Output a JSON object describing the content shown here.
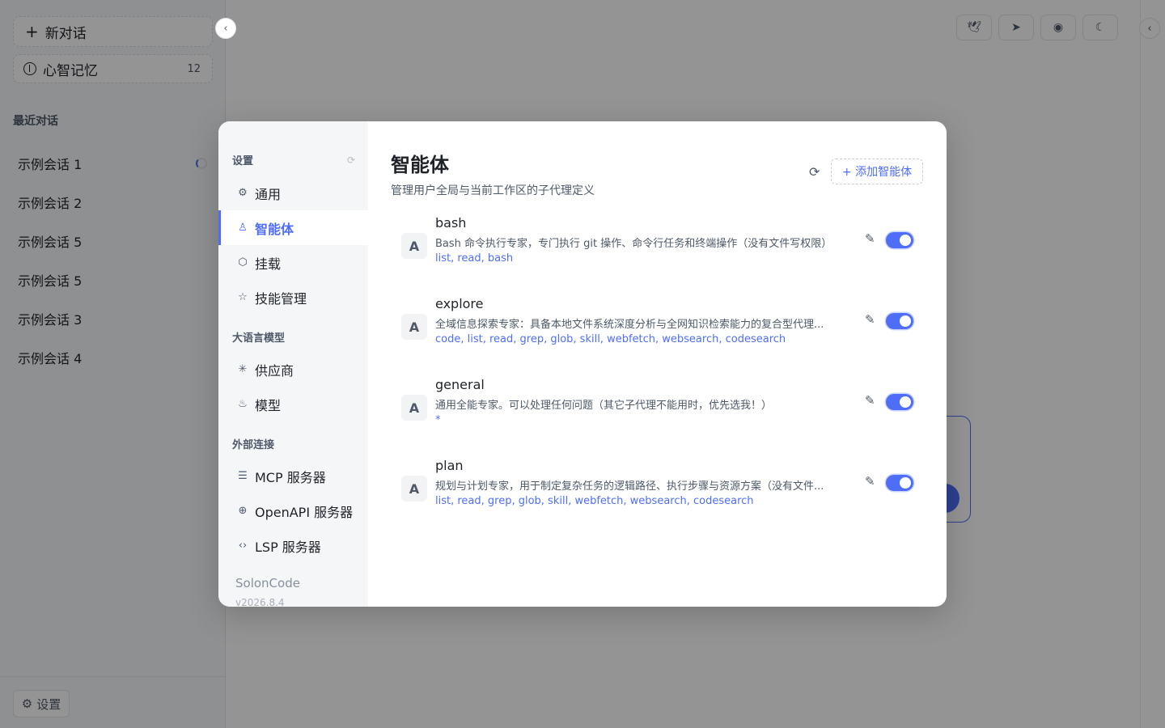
{
  "sidebar": {
    "new_chat_label": "新对话",
    "memory_label": "心智记忆",
    "memory_count": "12",
    "recent_heading": "最近对话",
    "recent": [
      "示例会话 1",
      "示例会话 2",
      "示例会话 5",
      "示例会话 5",
      "示例会话 3",
      "示例会话 4"
    ],
    "settings_label": "设置"
  },
  "settings": {
    "heading": "设置",
    "nav": {
      "general": "通用",
      "agents": "智能体",
      "mounts": "挂载",
      "skills": "技能管理"
    },
    "llm_group": "大语言模型",
    "llm_nav": {
      "providers": "供应商",
      "models": "模型"
    },
    "ext_group": "外部连接",
    "ext_nav": {
      "mcp": "MCP 服务器",
      "openapi": "OpenAPI 服务器",
      "lsp": "LSP 服务器"
    },
    "brand": "SolonCode",
    "version": "v2026.8.4"
  },
  "agents_page": {
    "title": "智能体",
    "subtitle": "管理用户全局与当前工作区的子代理定义",
    "add_label": "+ 添加智能体",
    "agents": [
      {
        "avatar": "A",
        "name": "bash",
        "desc": "Bash 命令执行专家，专门执行 git 操作、命令行任务和终端操作（没有文件写权限）",
        "tools": "list, read, bash",
        "enabled": true
      },
      {
        "avatar": "A",
        "name": "explore",
        "desc": "全域信息探索专家：具备本地文件系统深度分析与全网知识检索能力的复合型代理...",
        "tools": "code, list, read, grep, glob, skill, webfetch, websearch, codesearch",
        "enabled": true
      },
      {
        "avatar": "A",
        "name": "general",
        "desc": "通用全能专家。可以处理任何问题（其它子代理不能用时，优先选我！）",
        "tools": "*",
        "enabled": true
      },
      {
        "avatar": "A",
        "name": "plan",
        "desc": "规划与计划专家，用于制定复杂任务的逻辑路径、执行步骤与资源方案（没有文件...",
        "tools": "list, read, grep, glob, skill, webfetch, websearch, codesearch",
        "enabled": true
      }
    ]
  },
  "colors": {
    "accent": "#4f6ef7",
    "overlay": "rgba(0,0,0,0.42)"
  }
}
